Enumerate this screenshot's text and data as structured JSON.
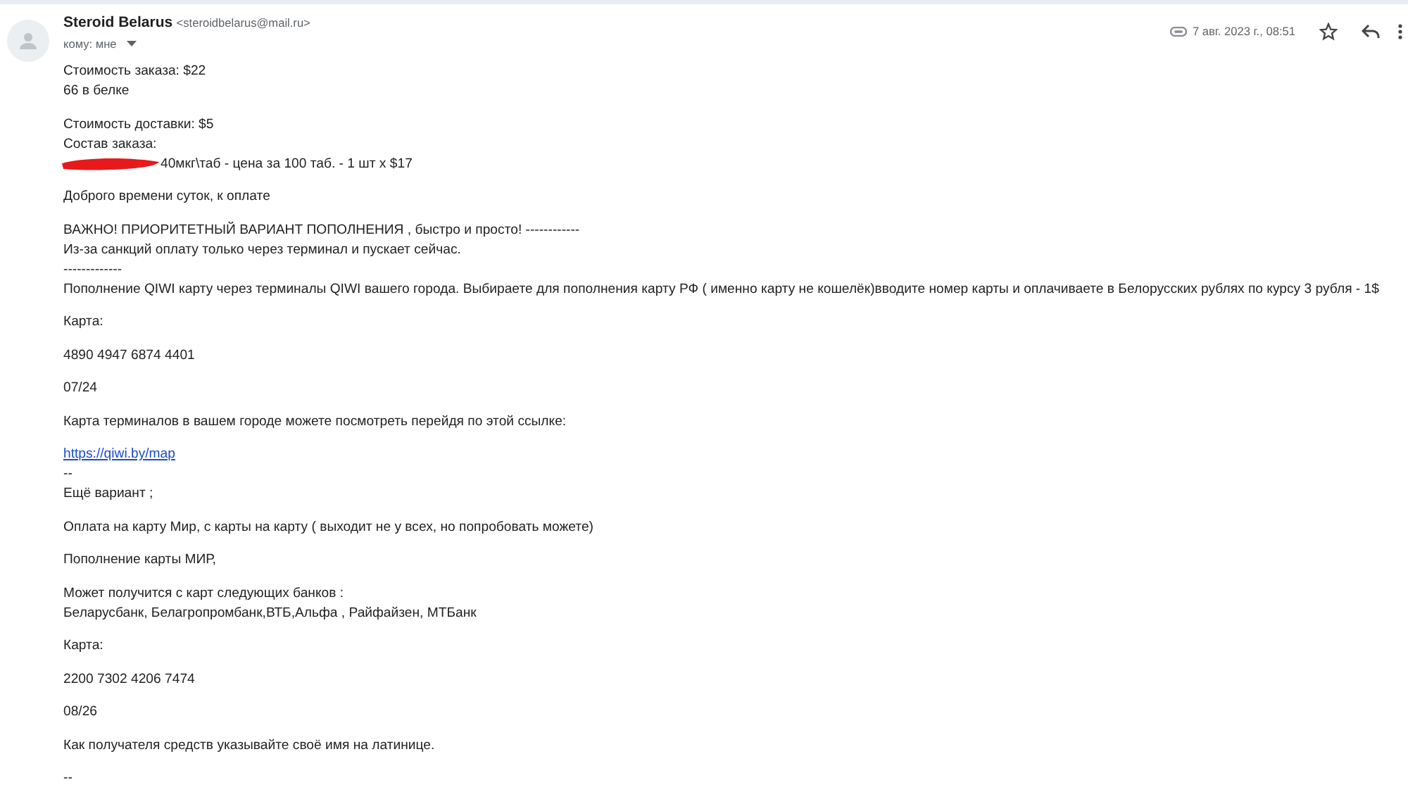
{
  "header": {
    "sender_name": "Steroid Belarus",
    "sender_email": "<steroidbelarus@mail.ru>",
    "recipient": "кому: мне",
    "date": "7 авг. 2023 г., 08:51",
    "starred": false
  },
  "body": [
    {
      "lines": [
        {
          "kind": "text",
          "text": "Стоимость заказа: $22"
        },
        {
          "kind": "text",
          "text": "66 в белке"
        }
      ]
    },
    {
      "lines": [
        {
          "kind": "text",
          "text": "Стоимость доставки: $5"
        },
        {
          "kind": "text",
          "text": "Состав заказа:"
        },
        {
          "kind": "redacted",
          "text": "40мкг\\таб - цена за 100 таб. - 1 шт x $17"
        }
      ]
    },
    {
      "lines": [
        {
          "kind": "text",
          "text": "Доброго времени суток, к оплате"
        }
      ]
    },
    {
      "lines": [
        {
          "kind": "text",
          "text": "ВАЖНО! ПРИОРИТЕТНЫЙ ВАРИАНТ ПОПОЛНЕНИЯ , быстро и просто! ------------"
        },
        {
          "kind": "text",
          "text": "Из-за санкций оплату только через терминал и пускает сейчас."
        },
        {
          "kind": "text",
          "text": "-------------"
        },
        {
          "kind": "text",
          "text": "Пополнение QIWI карту через терминалы QIWI вашего города. Выбираете для пополнения карту РФ ( именно карту не кошелёк)вводите номер карты и оплачиваете в Белорусских рублях по курсу 3 рубля - 1$"
        }
      ]
    },
    {
      "lines": [
        {
          "kind": "text",
          "text": "Карта:"
        }
      ]
    },
    {
      "lines": [
        {
          "kind": "text",
          "text": "4890 4947 6874 4401"
        }
      ]
    },
    {
      "lines": [
        {
          "kind": "text",
          "text": "07/24"
        }
      ]
    },
    {
      "lines": [
        {
          "kind": "text",
          "text": "Карта терминалов в вашем городе можете посмотреть перейдя по этой ссылке:"
        }
      ]
    },
    {
      "lines": [
        {
          "kind": "link",
          "text": "https://qiwi.by/map"
        },
        {
          "kind": "text",
          "text": "--"
        },
        {
          "kind": "text",
          "text": "Ещё вариант ;"
        }
      ]
    },
    {
      "lines": [
        {
          "kind": "text",
          "text": "Оплата на карту Мир, с карты на карту ( выходит не у всех, но попробовать можете)"
        }
      ]
    },
    {
      "lines": [
        {
          "kind": "text",
          "text": "Пополнение карты МИР,"
        }
      ]
    },
    {
      "lines": [
        {
          "kind": "text",
          "text": "Может получится с карт следующих банков :"
        },
        {
          "kind": "text",
          "text": "Беларусбанк, Белагропромбанк,ВТБ,Альфа , Райфайзен, МТБанк"
        }
      ]
    },
    {
      "lines": [
        {
          "kind": "text",
          "text": "Карта:"
        }
      ]
    },
    {
      "lines": [
        {
          "kind": "text",
          "text": "2200 7302 4206 7474"
        }
      ]
    },
    {
      "lines": [
        {
          "kind": "text",
          "text": "08/26"
        }
      ]
    },
    {
      "lines": [
        {
          "kind": "text",
          "text": "Как получателя средств указывайте своё имя на латинице."
        }
      ]
    },
    {
      "lines": [
        {
          "kind": "text",
          "text": "--"
        }
      ]
    }
  ]
}
